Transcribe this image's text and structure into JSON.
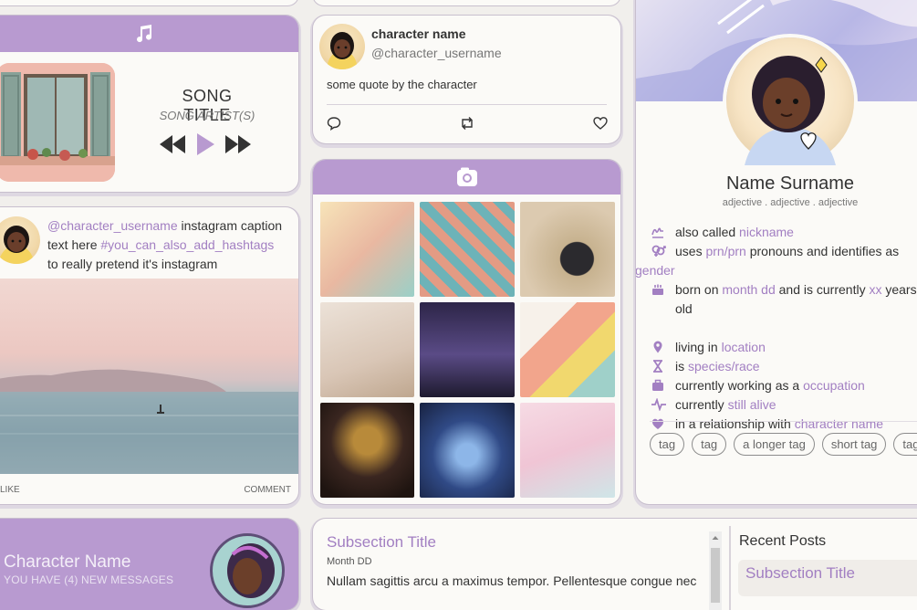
{
  "music": {
    "icon": "music-note-icon",
    "title": "SONG TITLE",
    "artist": "SONG ARTIST(S)",
    "controls": [
      "rewind-icon",
      "play-icon",
      "fast-forward-icon"
    ]
  },
  "tweet": {
    "name": "character name",
    "username": "@character_username",
    "quote": "some quote by the character",
    "actions": [
      "reply-icon",
      "retweet-icon",
      "heart-icon"
    ]
  },
  "insta": {
    "mention": "@character_username",
    "caption_a": " instagram caption text here ",
    "hashtag": "#you_can_also_add_hashtags",
    "caption_b": " to really pretend it's instagram",
    "like_label": "LIKE",
    "comment_label": "COMMENT"
  },
  "gallery": {
    "icon": "camera-icon",
    "tiles": [
      "#f3dfb8",
      "#e9a68f",
      "#c9b48c",
      "#e6d6c8",
      "#3b3160",
      "#f2b7a2",
      "#3a2a24",
      "#283a6e",
      "#f2d3df"
    ]
  },
  "profile": {
    "name": "Name Surname",
    "adjectives": "adjective . adjective . adjective",
    "facts": [
      {
        "icon": "signature-icon",
        "pre": "also called ",
        "link": "nickname",
        "post": ""
      },
      {
        "icon": "gender-icon",
        "pre": "uses ",
        "link": "prn/prn",
        "post": " pronouns and identifies as ",
        "link2": "gender"
      },
      {
        "icon": "birthday-cake-icon",
        "pre": "born on ",
        "link": "month dd",
        "post": " and is currently ",
        "link2": "xx",
        "post2": " years old"
      },
      {
        "icon": "location-pin-icon",
        "pre": "living in ",
        "link": "location",
        "post": ""
      },
      {
        "icon": "hourglass-icon",
        "pre": "is ",
        "link": "species/race",
        "post": ""
      },
      {
        "icon": "briefcase-icon",
        "pre": "currently working as a ",
        "link": "occupation",
        "post": ""
      },
      {
        "icon": "heartbeat-icon",
        "pre": "currently ",
        "link": "still alive",
        "post": ""
      },
      {
        "icon": "heart-icon",
        "pre": "in a relationship with ",
        "link": "character name",
        "post": ""
      }
    ],
    "tags": [
      "tag",
      "tag",
      "a longer tag",
      "short tag",
      "tag"
    ]
  },
  "messages": {
    "name": "Character Name",
    "count": "YOU HAVE (4) NEW MESSAGES"
  },
  "blog": {
    "subtitle": "Subsection Title",
    "date": "Month DD",
    "body": "Nullam sagittis arcu a maximus tempor. Pellentesque congue nec",
    "recent_title": "Recent Posts",
    "recent_sub": "Subsection Title"
  },
  "colors": {
    "accent": "#b89ad0",
    "link": "#a27fc2",
    "card": "#fbfaf7",
    "background": "#f1efec"
  }
}
